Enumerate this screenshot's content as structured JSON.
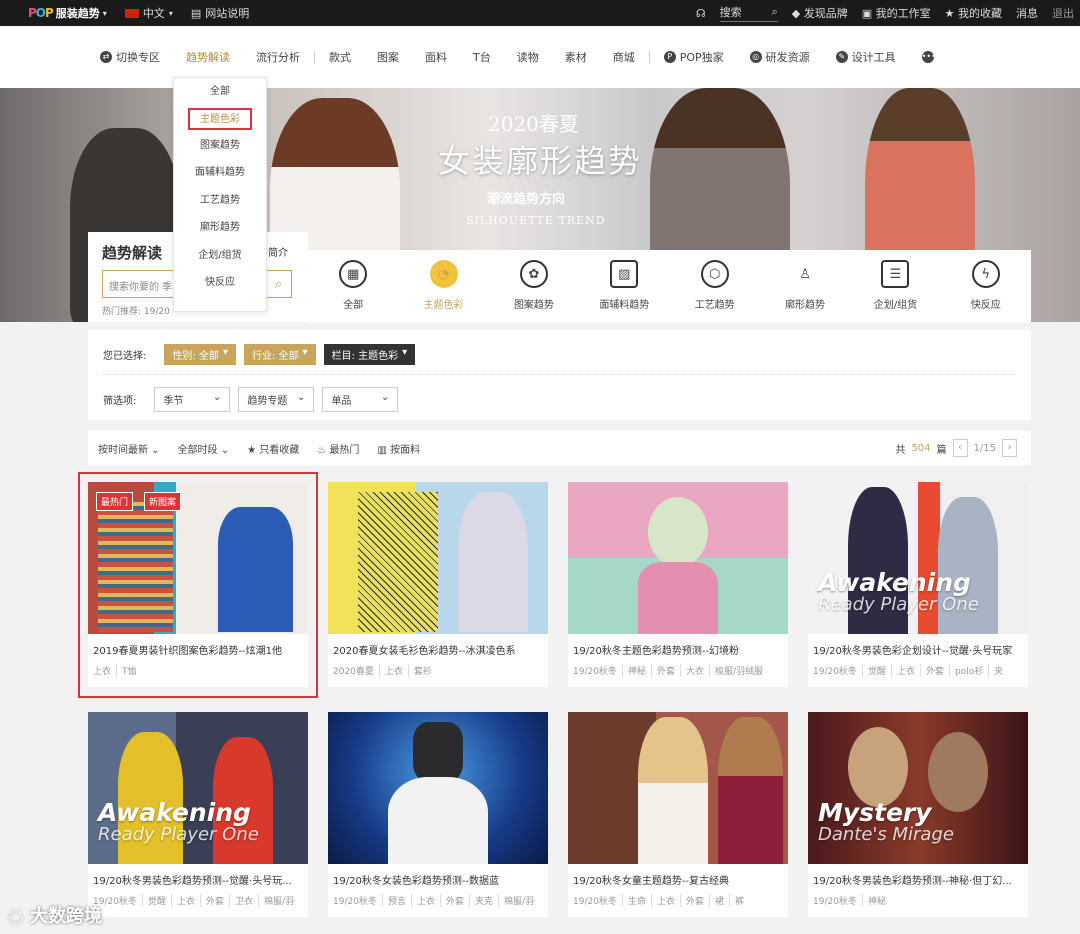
{
  "topbar": {
    "logo_pop": [
      "P",
      "O",
      "P"
    ],
    "logo_text": "服装趋势",
    "lang": "中文",
    "site_guide": "网站说明",
    "search": "搜索",
    "links": [
      "发现品牌",
      "我的工作室",
      "我的收藏",
      "消息",
      "退出"
    ]
  },
  "nav": {
    "items": [
      "切换专区",
      "趋势解读",
      "流行分析",
      "款式",
      "图案",
      "面料",
      "T台",
      "读物",
      "素材",
      "商城",
      "POP独家",
      "研发资源",
      "设计工具"
    ],
    "active": "趋势解读"
  },
  "dropdown": {
    "items": [
      "全部",
      "主题色彩",
      "图案趋势",
      "面辅料趋势",
      "工艺趋势",
      "廓形趋势",
      "企划/组货",
      "快反应"
    ],
    "selected": "主题色彩"
  },
  "banner": {
    "line1": "2020春夏",
    "line2": "女装廓形趋势",
    "line3": "潮流趋势方向",
    "line4": "SILHOUETTE TREND"
  },
  "trend_box": {
    "title": "趋势解读",
    "intro": "简介",
    "search_placeholder": "搜索你要的 季",
    "hot_prefix": "热门推荐: 19/20"
  },
  "categories": [
    "全部",
    "主题色彩",
    "图案趋势",
    "面辅料趋势",
    "工艺趋势",
    "廓形趋势",
    "企划/组货",
    "快反应"
  ],
  "category_active": "主题色彩",
  "filters": {
    "selected_label": "您已选择:",
    "selected_tags": [
      "性别: 全部",
      "行业: 全部",
      "栏目: 主题色彩"
    ],
    "options_label": "筛选项:",
    "options": [
      "季节",
      "趋势专题",
      "单品"
    ]
  },
  "sortbar": {
    "items": [
      "按时间最新",
      "全部时段",
      "只看收藏",
      "最热门",
      "按面料"
    ],
    "total_prefix": "共",
    "total": "504",
    "total_suffix": "篇",
    "page": "1/15"
  },
  "cards": [
    {
      "title": "2019春夏男装针织图案色彩趋势--炫潮1他",
      "tags": [
        "上衣",
        "T恤"
      ],
      "badges": [
        "最热门",
        "新图案"
      ]
    },
    {
      "title": "2020春夏女装毛衫色彩趋势--冰淇凌色系",
      "tags": [
        "2020春夏",
        "上衣",
        "套衫"
      ]
    },
    {
      "title": "19/20秋冬主题色彩趋势预测--幻境粉",
      "tags": [
        "19/20秋冬",
        "神秘",
        "外套",
        "大衣",
        "梭服/羽绒服"
      ]
    },
    {
      "title": "19/20秋冬男装色彩企划设计--觉醒·头号玩家",
      "tags": [
        "19/20秋冬",
        "觉醒",
        "上衣",
        "外套",
        "polo衫",
        "夹"
      ],
      "overlay": [
        "Awakening",
        "Ready Player One"
      ]
    },
    {
      "title": "19/20秋冬男装色彩趋势预测--觉醒·头号玩...",
      "tags": [
        "19/20秋冬",
        "觉醒",
        "上衣",
        "外套",
        "卫衣",
        "棉服/羽"
      ],
      "overlay": [
        "Awakening",
        "Ready Player One"
      ]
    },
    {
      "title": "19/20秋冬女装色彩趋势预测--数据蓝",
      "tags": [
        "19/20秋冬",
        "预言",
        "上衣",
        "外套",
        "夹克",
        "棉服/羽"
      ]
    },
    {
      "title": "19/20秋冬女童主题趋势--复古经典",
      "tags": [
        "19/20秋冬",
        "生命",
        "上衣",
        "外套",
        "裙",
        "裤"
      ]
    },
    {
      "title": "19/20秋冬男装色彩趋势预测--神秘·但丁幻...",
      "tags": [
        "19/20秋冬",
        "神秘"
      ],
      "overlay": [
        "Mystery",
        "Dante's Mirage"
      ]
    }
  ],
  "watermark": "大数跨境",
  "colors": {
    "accent": "#c9a45c",
    "highlight": "#d9343a",
    "dark": "#1a1a1a"
  }
}
